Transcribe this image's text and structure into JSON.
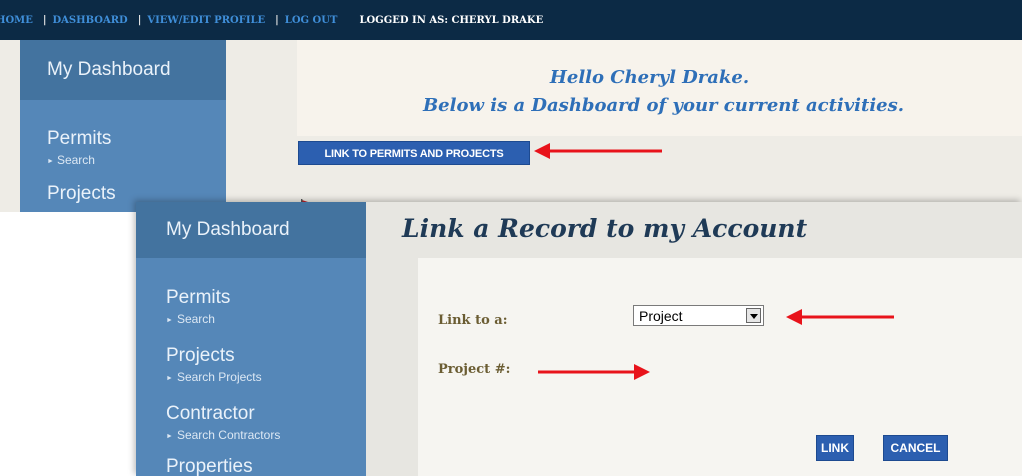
{
  "top_nav": {
    "home": "HOME",
    "dashboard": "DASHBOARD",
    "view_edit_profile": "VIEW/EDIT PROFILE",
    "log_out": "LOG OUT",
    "logged_in_as": "LOGGED IN AS:  CHERYL DRAKE",
    "separator": "|"
  },
  "sidebar_top": {
    "title": "My Dashboard",
    "permits": "Permits",
    "permits_sub": "Search",
    "projects": "Projects"
  },
  "welcome": {
    "line1": "Hello Cheryl Drake.",
    "line2": "Below is a Dashboard of your current activities."
  },
  "link_button_label": "LINK TO PERMITS AND PROJECTS",
  "sidebar_bottom": {
    "title": "My Dashboard",
    "items": [
      {
        "label": "Permits",
        "sub": "Search"
      },
      {
        "label": "Projects",
        "sub": "Search Projects"
      },
      {
        "label": "Contractor",
        "sub": "Search Contractors"
      },
      {
        "label": "Properties",
        "sub": ""
      }
    ]
  },
  "form": {
    "title": "Link a Record to my Account",
    "link_to_label": "Link to a:",
    "link_to_value": "Project",
    "project_number_label": "Project #:",
    "link_button": "LINK",
    "cancel_button": "CANCEL"
  },
  "colors": {
    "nav_bg": "#0c2a45",
    "sidebar": "#5587b8",
    "button": "#2c5fb0",
    "arrow": "#e8131b"
  }
}
